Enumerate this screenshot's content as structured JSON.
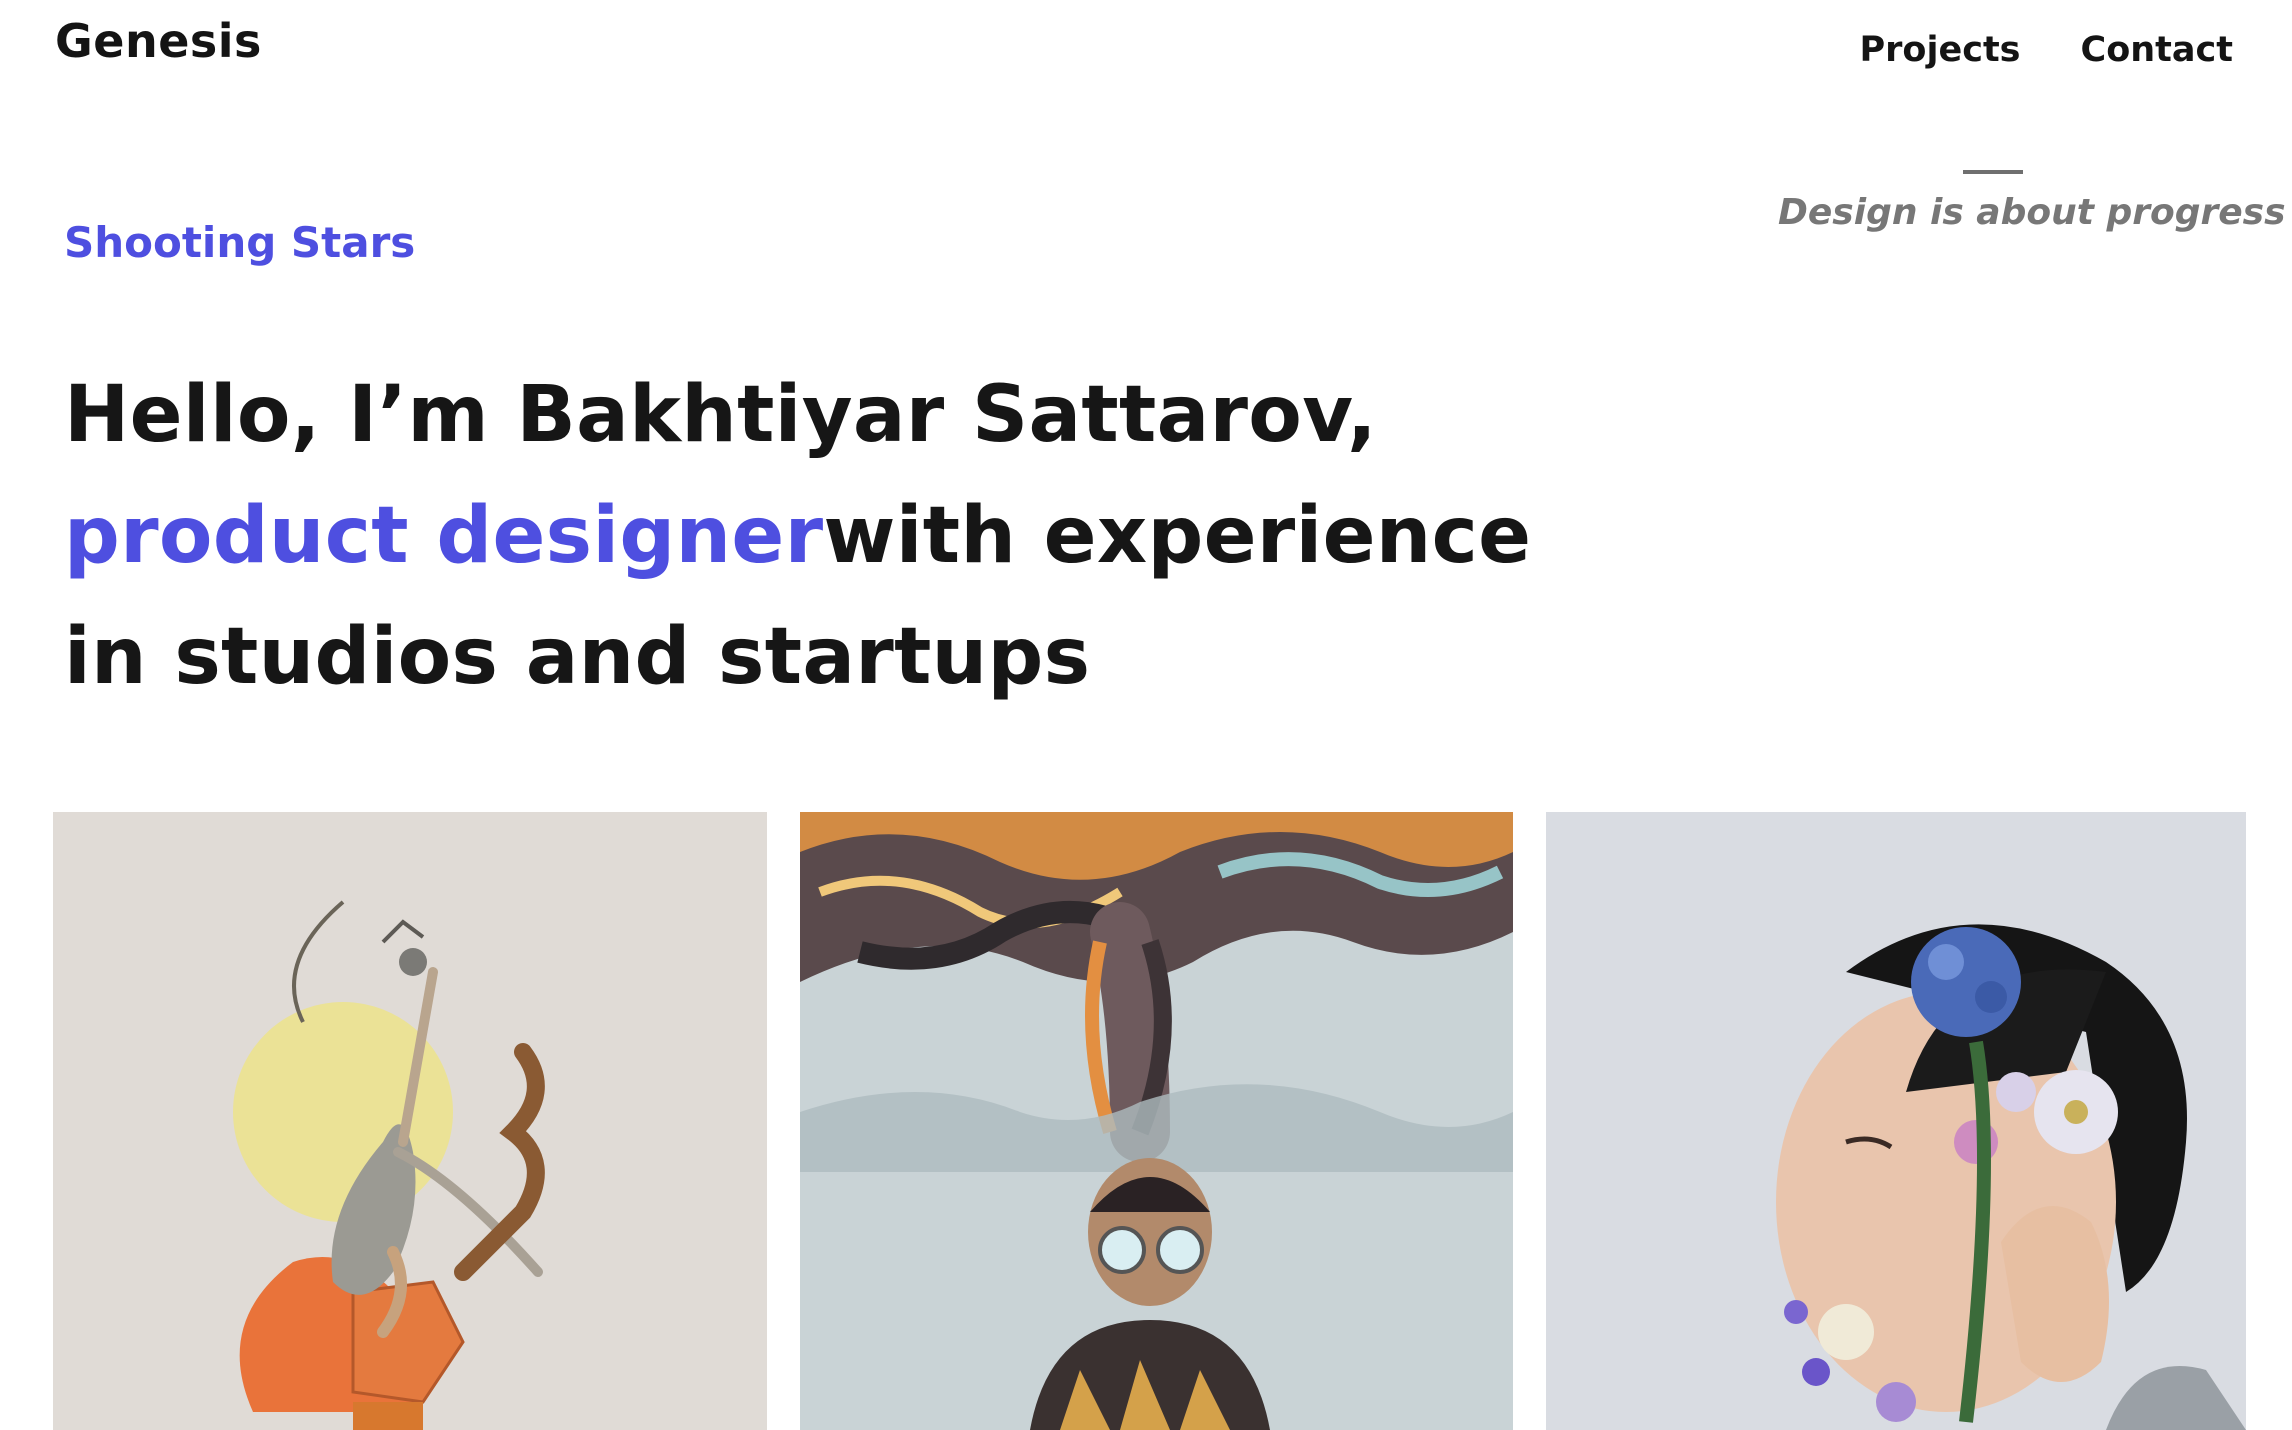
{
  "header": {
    "logo": "Genesis",
    "nav": [
      {
        "label": "Projects"
      },
      {
        "label": "Contact"
      }
    ]
  },
  "tagline": "Design is about progress",
  "eyebrow": "Shooting Stars",
  "hero": {
    "line1": "Hello, I’m Bakhtiyar Sattarov,",
    "line2_accent": "product designer",
    "line2_rest": "with experience",
    "line3": "in studios and startups"
  },
  "colors": {
    "accent": "#4e4fe0",
    "text": "#161616",
    "muted": "#777777"
  }
}
